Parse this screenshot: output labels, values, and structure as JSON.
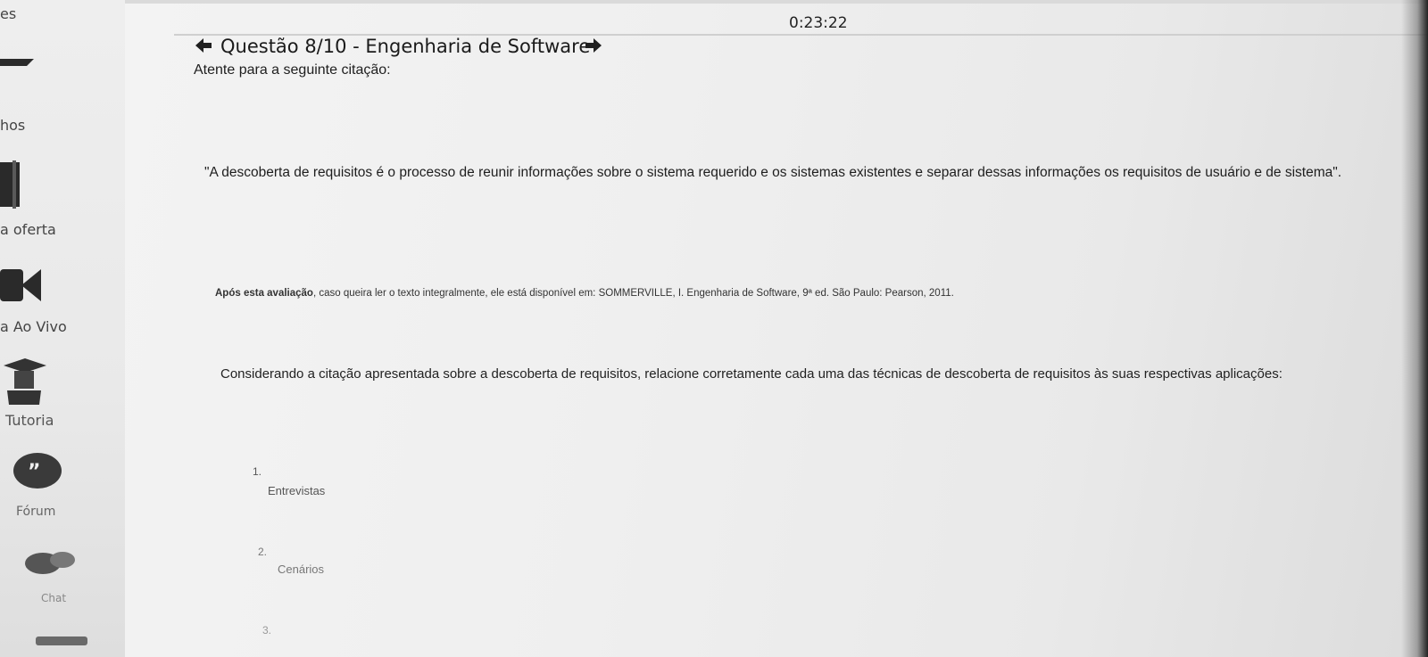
{
  "sidebar": {
    "items": [
      {
        "label": "es"
      },
      {
        "label": "hos"
      },
      {
        "label": "a oferta"
      },
      {
        "label": "a Ao Vivo"
      },
      {
        "label": "Tutoria"
      },
      {
        "label": "Fórum"
      },
      {
        "label": "Chat"
      }
    ]
  },
  "header": {
    "timer": "0:23:22",
    "question_title": "Questão 8/10 - Engenharia de Software"
  },
  "question": {
    "intro": "Atente para a seguinte citação:",
    "quote": "\"A descoberta de requisitos é o processo de reunir informações sobre o sistema requerido e os sistemas existentes e separar dessas informações os requisitos de usuário e de sistema\".",
    "source_bold": "Após esta avaliação",
    "source_rest": ", caso queira ler o texto integralmente, ele está disponível em: SOMMERVILLE, I. Engenharia de Software, 9ª ed. São Paulo: Pearson, 2011.",
    "instruction": "Considerando a citação apresentada sobre a descoberta de requisitos, relacione corretamente cada uma das técnicas de descoberta de requisitos às suas respectivas aplicações:",
    "items": [
      {
        "num": "1.",
        "text": "Entrevistas"
      },
      {
        "num": "2.",
        "text": "Cenários"
      },
      {
        "num": "3.",
        "text": ""
      }
    ]
  },
  "icons": {
    "back": "arrow-left-icon",
    "next": "arrow-right-icon"
  }
}
